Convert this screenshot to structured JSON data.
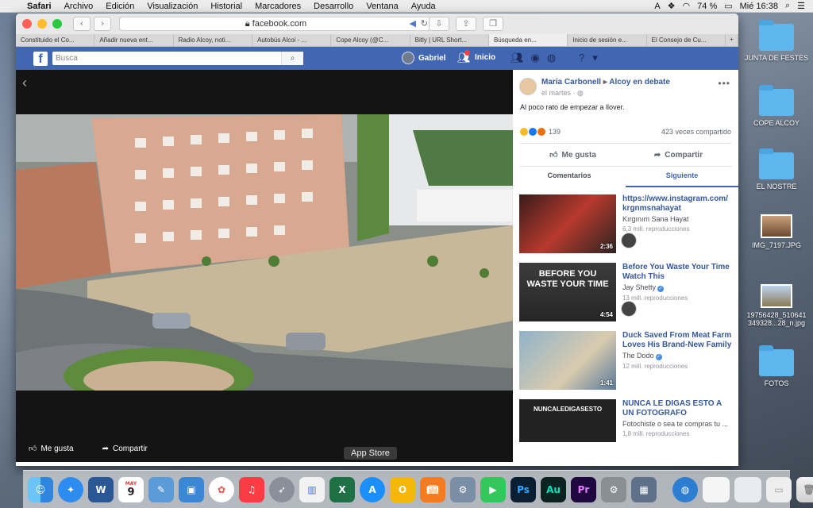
{
  "menubar": {
    "items": [
      "Safari",
      "Archivo",
      "Edición",
      "Visualización",
      "Historial",
      "Marcadores",
      "Desarrollo",
      "Ventana",
      "Ayuda"
    ],
    "battery": "74 %",
    "clock": "Mié 16:38"
  },
  "browser": {
    "url": "facebook.com",
    "tabs": [
      "Constituido el Co...",
      "Añadir nueva ent...",
      "Radio Alcoy, noti...",
      "Autobús Alcoi - ...",
      "Cope Alcoy (@C...",
      "Bitly | URL Short...",
      "Búsqueda en...",
      "Inicio de sesión e...",
      "El Consejo de Cu..."
    ],
    "active_tab": 6
  },
  "facebook": {
    "search_placeholder": "Busca",
    "user_name": "Gabriel",
    "home_label": "Inicio"
  },
  "video": {
    "like_label": "Me gusta",
    "share_label": "Compartir"
  },
  "post": {
    "author": "María Carbonell",
    "group": "Alcoy en debate",
    "time": "el martes",
    "text": "Al poco rato de empezar a llover.",
    "reaction_count": "139",
    "shares": "423 veces compartido",
    "like_label": "Me gusta",
    "share_label": "Compartir",
    "tab_comments": "Comentarios",
    "tab_next": "Siguiente"
  },
  "suggestions": [
    {
      "title": "https://www.instagram.com/ krgnmsnahayat",
      "channel": "Kırgınım Sana Hayat",
      "views": "6,3 mill. reproducciones",
      "duration": "2:36",
      "thumb_text": ""
    },
    {
      "title": "Before You Waste Your Time Watch This",
      "channel": "Jay Shetty",
      "views": "13 mill. reproducciones",
      "duration": "4:54",
      "thumb_text": "BEFORE YOU WASTE YOUR TIME"
    },
    {
      "title": "Duck Saved From Meat Farm Loves His Brand-New Family",
      "channel": "The Dodo",
      "views": "12 mill. reproducciones",
      "duration": "1:41",
      "thumb_text": ""
    },
    {
      "title": "NUNCA LE DIGAS ESTO A UN FOTOGRAFO",
      "channel": "Fotochiste o sea te compras tu ...",
      "views": "1,8 mill. reproducciones",
      "duration": "",
      "thumb_text": "NUNCALEDIGASESTO"
    }
  ],
  "desktop": [
    {
      "label": "JUNTA DE FESTES",
      "kind": "folder"
    },
    {
      "label": "COPE ALCOY",
      "kind": "folder"
    },
    {
      "label": "EL NOSTRE",
      "kind": "folder"
    },
    {
      "label": "IMG_7197.JPG",
      "kind": "image"
    },
    {
      "label": "19756428_510641 349328...28_n.jpg",
      "kind": "image"
    },
    {
      "label": "FOTOS",
      "kind": "folder"
    }
  ],
  "tooltip": "App Store",
  "calendar_day": "9",
  "calendar_month": "MAY",
  "colors": {
    "fb_blue": "#4267b2",
    "link_blue": "#365899",
    "desktop_folder": "#5fb6ee"
  },
  "dock": [
    "finder",
    "safari",
    "word",
    "calendar",
    "preview",
    "keynote",
    "photos",
    "music",
    "launchpad",
    "charts",
    "excel",
    "app-store",
    "outlook",
    "books",
    "migration",
    "facetime",
    "photoshop",
    "audition",
    "premiere",
    "system-preferences",
    "image-capture",
    "network",
    "window",
    "window",
    "trash"
  ]
}
